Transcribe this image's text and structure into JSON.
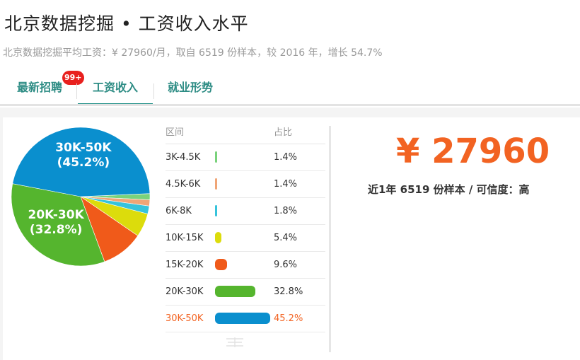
{
  "header": {
    "title": "北京数据挖掘 • 工资收入水平",
    "subtitle": "北京数据挖掘平均工资：¥ 27960/月，取自 6519 份样本，较 2016 年，增长 54.7%"
  },
  "tabs": [
    {
      "label": "最新招聘",
      "badge": "99+"
    },
    {
      "label": "工资收入",
      "active": true
    },
    {
      "label": "就业形势"
    }
  ],
  "table": {
    "headers": {
      "range": "区间",
      "ratio": "占比"
    }
  },
  "summary": {
    "average": "¥ 27960",
    "sample_text": "近1年 6519 份样本 / 可信度：高"
  },
  "chart_data": {
    "type": "pie",
    "categories": [
      "3K-4.5K",
      "4.5K-6K",
      "6K-8K",
      "10K-15K",
      "15K-20K",
      "20K-30K",
      "30K-50K"
    ],
    "values": [
      1.4,
      1.4,
      1.8,
      5.4,
      9.6,
      32.8,
      45.2
    ],
    "value_labels": [
      "1.4%",
      "1.4%",
      "1.8%",
      "5.4%",
      "9.6%",
      "32.8%",
      "45.2%"
    ],
    "colors": [
      "#79d27b",
      "#f0a576",
      "#36c3db",
      "#dcdc0c",
      "#f05a1a",
      "#55b52e",
      "#0a8fce"
    ],
    "highlight": "30K-50K",
    "highlight_color": "#f26322",
    "slice_labels": [
      {
        "category": "30K-50K",
        "text": "30K-50K",
        "pct": "(45.2%)"
      },
      {
        "category": "20K-30K",
        "text": "20K-30K",
        "pct": "(32.8%)"
      }
    ]
  }
}
